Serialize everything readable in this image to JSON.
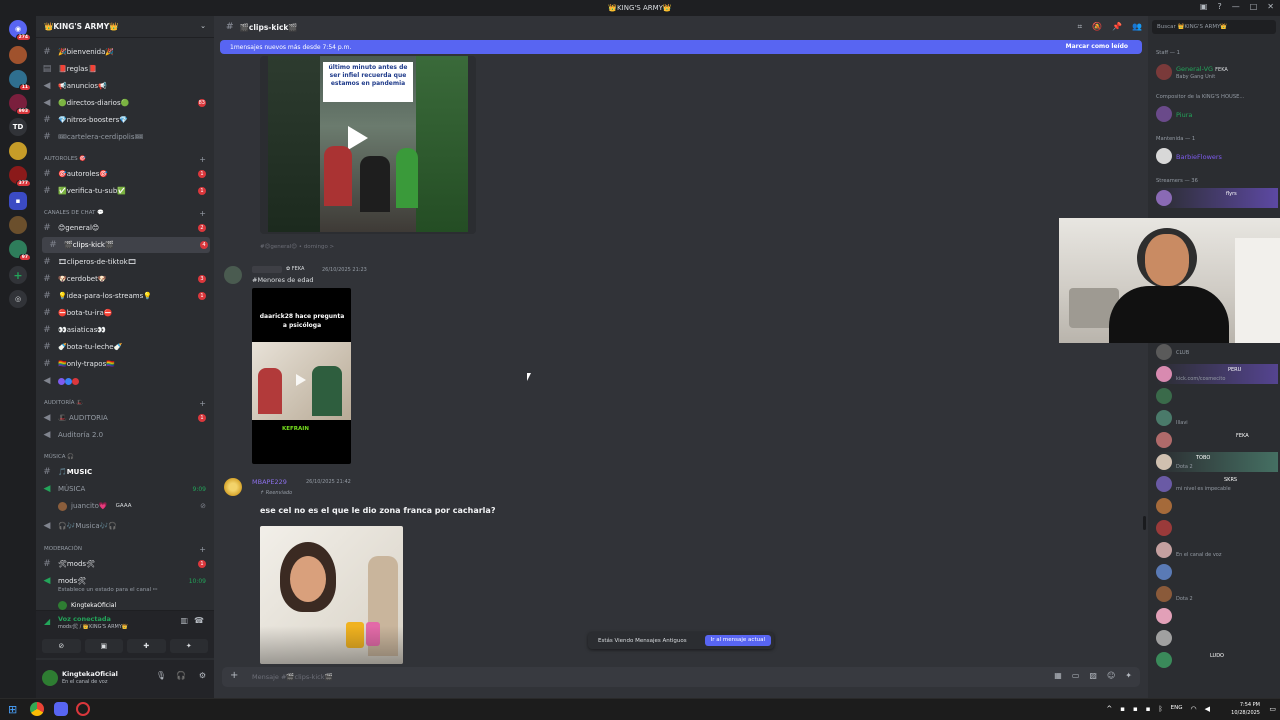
{
  "window": {
    "title": "👑KING'S ARMY👑"
  },
  "servers": [
    {
      "label": "",
      "badge": "274"
    },
    {
      "label": "",
      "badge": ""
    },
    {
      "label": "",
      "badge": "11"
    },
    {
      "label": "",
      "badge": "993"
    },
    {
      "label": "TD",
      "badge": ""
    },
    {
      "label": "",
      "badge": ""
    },
    {
      "label": "",
      "badge": "377"
    },
    {
      "label": "",
      "badge": ""
    },
    {
      "label": "",
      "badge": ""
    },
    {
      "label": "",
      "badge": "97"
    }
  ],
  "server_name": "👑KING'S ARMY👑",
  "channels": [
    {
      "label": "🎉bienvenida🎉",
      "badge": ""
    },
    {
      "label": "📕reglas📕",
      "badge": ""
    },
    {
      "label": "📢anuncios📢",
      "badge": ""
    },
    {
      "label": "🟢directos-diarios🟢",
      "badge": "83"
    },
    {
      "label": "💎nitros-boosters💎",
      "badge": ""
    },
    {
      "label": "🎟cartelera-cerdipolis🎟",
      "badge": ""
    }
  ],
  "categories": {
    "autoroles": "AUTOROLES 🎯",
    "chat": "CANALES DE CHAT 💬",
    "auditoria": "AUDITORÍA 🎩",
    "musica": "MÚSICA 🎧",
    "moderacion": "MODERACIÓN"
  },
  "autoroles_channels": [
    {
      "label": "🎯autoroles🎯",
      "badge": "1"
    },
    {
      "label": "✅verifica-tu-sub✅",
      "badge": "1"
    }
  ],
  "chat_channels": [
    {
      "label": "😊general😊",
      "badge": "2"
    },
    {
      "label": "🎬clips-kick🎬",
      "badge": "4"
    },
    {
      "label": "🎞cliperos-de-tiktok🎞",
      "badge": ""
    },
    {
      "label": "🐶cerdobet🐶",
      "badge": "3"
    },
    {
      "label": "💡idea-para-los-streams💡",
      "badge": "1"
    },
    {
      "label": "⛔bota-tu-ira⛔",
      "badge": ""
    },
    {
      "label": "👀asiaticas👀",
      "badge": ""
    },
    {
      "label": "🍼bota-tu-leche🍼",
      "badge": ""
    },
    {
      "label": "🏳️‍🌈only-trapos🏳️‍🌈",
      "badge": ""
    }
  ],
  "auditoria_channels": [
    {
      "label": "🎩 AUDITORIA",
      "badge": "1"
    },
    {
      "label": "Auditoría 2.0",
      "badge": ""
    }
  ],
  "musica_channels": [
    {
      "label": "🎵MUSIC",
      "badge": ""
    },
    {
      "label": "MÚSICA",
      "badge": "",
      "time": "9:09"
    },
    {
      "label": "juancito💗",
      "tag": "GAAA"
    },
    {
      "label": "🎧🎶Musica🎶🎧",
      "badge": ""
    }
  ],
  "mod_channels": [
    {
      "label": "🛠mods🛠",
      "badge": "1"
    },
    {
      "label": "mods🛠",
      "time": "10:09"
    }
  ],
  "mod_status_hint": "Establece un estado para el canal ✏",
  "mod_voice_user": "KingtekaOficial",
  "voice": {
    "status": "Voz conectada",
    "location": "mods🛠 / 👑KING'S ARMY👑"
  },
  "user": {
    "name": "KingtekaOficial",
    "status": "En el canal de voz"
  },
  "chat": {
    "channel": "🎬clips-kick🎬",
    "new_messages": "1mensajes nuevos más desde 7:54 p.m.",
    "mark_read": "Marcar como leído",
    "video1_caption": "último minuto antes de ser infiel recuerda que estamos en pandemia",
    "forward_source": "#😊general😊 • domingo >",
    "msg1": {
      "tag": "FEKA",
      "time": "26/10/2025 21:23",
      "text": "#Menores de edad"
    },
    "video2_caption": "daarick28 hace pregunta a psicóloga",
    "video2_logo": "KEFRAIN",
    "msg2": {
      "user": "MBAPE229",
      "time": "26/10/2025 21:42",
      "forwarded": "↱ Reenviado",
      "text": "ese cel no es el que le dio zona franca por cacharla?"
    },
    "old_messages": "Estás Viendo Mensajes Antiguos",
    "jump": "Ir al mensaje actual",
    "composer_placeholder": "Mensaje #🎬clips-kick🎬"
  },
  "members": {
    "search_placeholder": "Buscar 👑KING'S ARMY👑",
    "groups": [
      {
        "label": "Staff — 1"
      },
      {
        "label": "Compositor de la KING'S HOUSE..."
      },
      {
        "label": "Mantenida — 1"
      },
      {
        "label": "Streamers — 36"
      }
    ],
    "list": [
      {
        "name": "General-VG",
        "tag": "FEKA",
        "status": "Baby Gang Unit",
        "color": "#23a55a"
      },
      {
        "name": "Piura",
        "tag": "",
        "status": "",
        "color": "#23a55a"
      },
      {
        "name": "BarbieFlowers",
        "tag": "",
        "status": "",
        "color": "#7e5bef"
      },
      {
        "name": "",
        "tag": "flyrs",
        "status": "",
        "color": "#7e5bef"
      },
      {
        "name": "",
        "tag": "",
        "status": "CLUB",
        "color": "#7e5bef"
      },
      {
        "name": "",
        "tag": "PERU",
        "status": "kick.com/cosmecito",
        "color": "#7e5bef"
      },
      {
        "name": "",
        "tag": "",
        "status": "",
        "color": "#7e5bef"
      },
      {
        "name": "",
        "tag": "",
        "status": "Illavi",
        "color": "#7e5bef"
      },
      {
        "name": "",
        "tag": "FEKA",
        "status": "",
        "color": "#7e5bef"
      },
      {
        "name": "",
        "tag": "TOBO",
        "status": "Dota 2",
        "color": "#7e5bef"
      },
      {
        "name": "",
        "tag": "SKRS",
        "status": "mi nivel es impecable",
        "color": "#7e5bef"
      },
      {
        "name": "",
        "tag": "",
        "status": "",
        "color": "#7e5bef"
      },
      {
        "name": "",
        "tag": "",
        "status": "",
        "color": "#7e5bef"
      },
      {
        "name": "",
        "tag": "",
        "status": "En el canal de voz",
        "color": "#7e5bef"
      },
      {
        "name": "",
        "tag": "",
        "status": "",
        "color": "#7e5bef"
      },
      {
        "name": "",
        "tag": "",
        "status": "Dota 2",
        "color": "#7e5bef"
      },
      {
        "name": "",
        "tag": "",
        "status": "",
        "color": "#7e5bef"
      },
      {
        "name": "",
        "tag": "",
        "status": "",
        "color": "#7e5bef"
      },
      {
        "name": "",
        "tag": "LUDO",
        "status": "",
        "color": "#7e5bef"
      }
    ]
  },
  "taskbar": {
    "lang": "ENG",
    "time": "7:54 PM",
    "date": "10/28/2025"
  }
}
